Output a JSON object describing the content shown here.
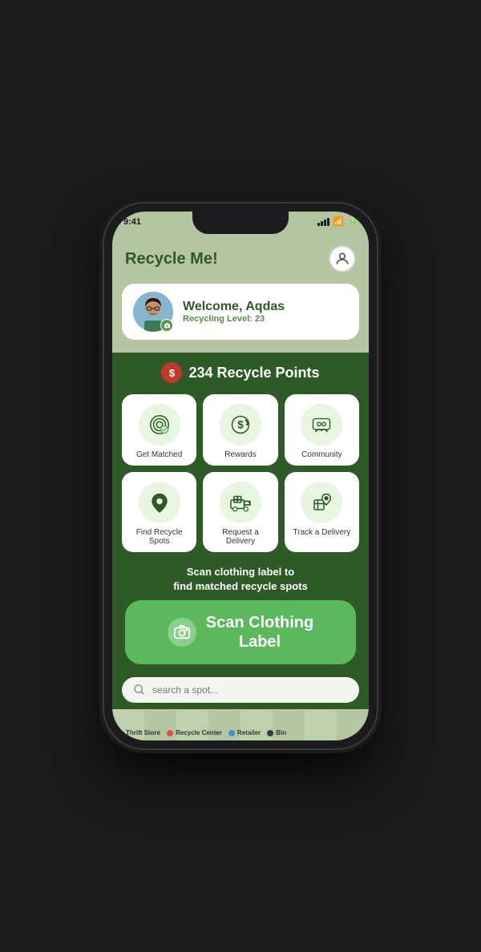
{
  "status_bar": {
    "time": "9:41"
  },
  "header": {
    "title": "Recycle Me!",
    "avatar_label": "User Profile"
  },
  "user_card": {
    "welcome": "Welcome, Aqdas",
    "level": "Recycling Level: 23"
  },
  "points": {
    "value": "234 Recycle Points"
  },
  "grid": [
    {
      "id": "get-matched",
      "label": "Get Matched"
    },
    {
      "id": "rewards",
      "label": "Rewards"
    },
    {
      "id": "community",
      "label": "Community"
    },
    {
      "id": "find-recycle-spots",
      "label": "Find Recycle Spots"
    },
    {
      "id": "request-delivery",
      "label": "Request a Delivery"
    },
    {
      "id": "track-delivery",
      "label": "Track a Delivery"
    }
  ],
  "scan_section": {
    "hint": "Scan clothing label to\nfind matched recycle spots",
    "button_label": "Scan Clothing\nLabel"
  },
  "search": {
    "placeholder": "search a spot..."
  },
  "map_legend": [
    {
      "color": "#5cb85c",
      "label": "Thrift Store"
    },
    {
      "color": "#e74c3c",
      "label": "Recycle Center"
    },
    {
      "color": "#3498db",
      "label": "Retailer"
    },
    {
      "color": "#2c3e50",
      "label": "Bin"
    }
  ],
  "colors": {
    "primary_green": "#2d5a27",
    "light_green": "#5cb85c",
    "header_bg": "#b5c4a1",
    "icon_circle": "#e8f5e0"
  }
}
